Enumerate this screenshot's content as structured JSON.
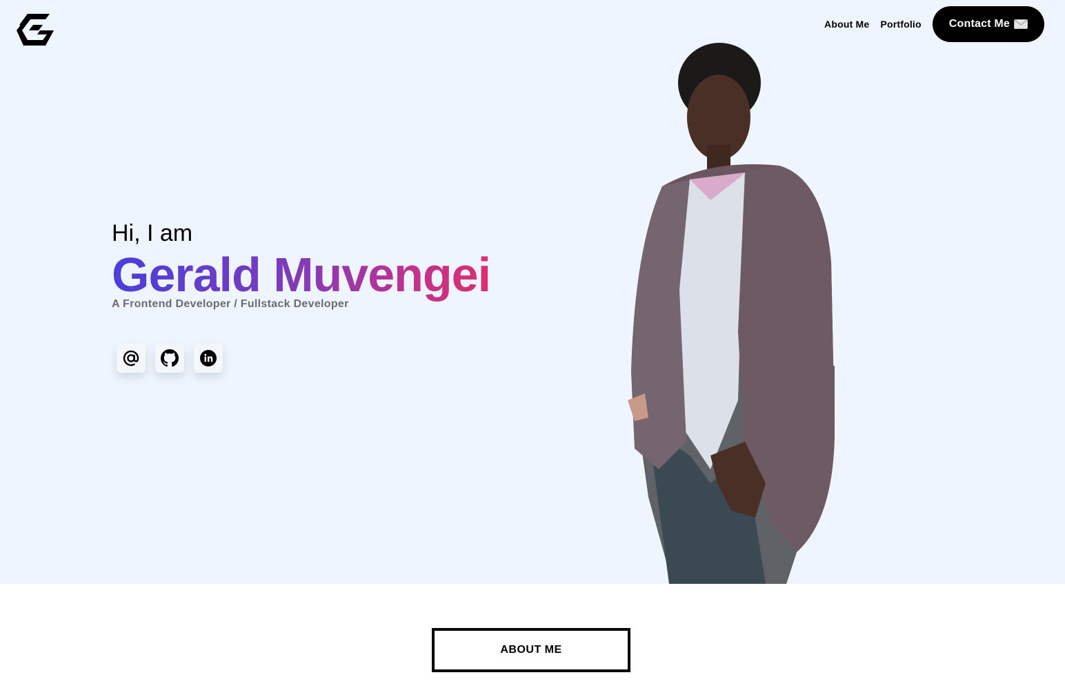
{
  "nav": {
    "about_label": "About Me",
    "portfolio_label": "Portfolio",
    "contact_label": "Contact Me"
  },
  "hero": {
    "greeting": "Hi, I am",
    "name": "Gerald Muvengei",
    "role": "A Frontend Developer / Fullstack Developer"
  },
  "socials": [
    {
      "icon": "at-sign-icon"
    },
    {
      "icon": "github-icon"
    },
    {
      "icon": "linkedin-icon"
    }
  ],
  "about_section": {
    "button_label": "ABOUT ME"
  },
  "colors": {
    "hero_background": "#eef5fe",
    "gradient_start": "#4a3fdb",
    "gradient_end": "#dc2f6e",
    "contact_button": "#000000"
  }
}
